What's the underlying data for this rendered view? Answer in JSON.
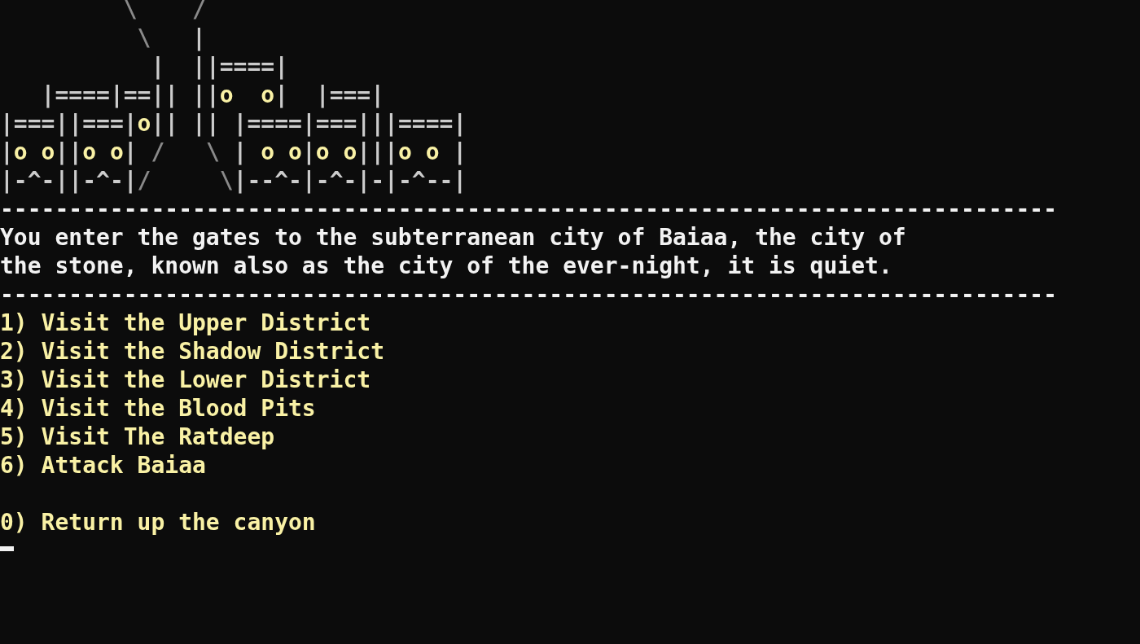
{
  "ascii_art": [
    "         \\    /",
    "          \\   |",
    "           |  ||====|",
    "   |====|==|| ||o  o|  |===|",
    "|===||===|o|| || |====|===|||====|",
    "|o o||o o| /   \\ | o o|o o|||o o |",
    "|-^-||-^-|/     \\|--^-|-^-|-|-^--|"
  ],
  "separator_top": "-----------------------------------------------------------------------------",
  "description_lines": [
    "You enter the gates to the subterranean city of Baiaa, the city of",
    "the stone, known also as the city of the ever-night, it is quiet."
  ],
  "separator_bottom": "-----------------------------------------------------------------------------",
  "menu": [
    {
      "kind": "option",
      "text": "1) Visit the Upper District"
    },
    {
      "kind": "option",
      "text": "2) Visit the Shadow District"
    },
    {
      "kind": "option",
      "text": "3) Visit the Lower District"
    },
    {
      "kind": "option",
      "text": "4) Visit the Blood Pits"
    },
    {
      "kind": "option",
      "text": "5) Visit The Ratdeep"
    },
    {
      "kind": "option",
      "text": "6) Attack Baiaa"
    },
    {
      "kind": "gap"
    },
    {
      "kind": "option",
      "text": "0) Return up the canyon"
    }
  ],
  "cursor": {
    "visible": true
  }
}
